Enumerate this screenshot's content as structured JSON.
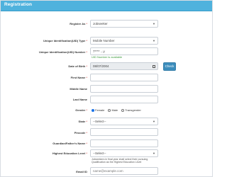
{
  "header": {
    "title": "Registration"
  },
  "form": {
    "register_as": {
      "label": "Register As",
      "value": "Jobseeker"
    },
    "uid_type": {
      "label": "Unique Identification(UID) Type",
      "value": "Mobile Number"
    },
    "uid_number": {
      "label": "Unique Identification(UID) Number",
      "value": "7**** ...y",
      "status": "UID Number is available"
    },
    "dob": {
      "label": "Date of Birth",
      "value": "08/07/2004"
    },
    "check_button": "Check",
    "first_name": {
      "label": "First Name",
      "value": ""
    },
    "middle_name": {
      "label": "Middle Name",
      "value": ""
    },
    "last_name": {
      "label": "Last Name",
      "value": ""
    },
    "gender": {
      "label": "Gender",
      "options": [
        "Female",
        "Male",
        "Transgender"
      ],
      "selected": "Female"
    },
    "state": {
      "label": "State",
      "value": "--Select--"
    },
    "pincode": {
      "label": "Pincode",
      "value": ""
    },
    "guardian_name": {
      "label": "Guardian/Father's Name",
      "value": ""
    },
    "education": {
      "label": "Highest Education Level",
      "value": "--Select--",
      "hint": "Jobseekers in final year shall select their pursuing Qualification as the Highest Education Level"
    },
    "email": {
      "label": "Email ID",
      "placeholder": "name@example.com"
    }
  },
  "required_mark": "*",
  "colors": {
    "header": "#4fb2dd",
    "button": "#3c8dbc",
    "status_ok": "#3c9a3c",
    "required": "#d9534f"
  },
  "icons": {
    "dropdown": "chevron-down-icon",
    "calendar": "calendar-icon",
    "radio": "radio-icon"
  }
}
